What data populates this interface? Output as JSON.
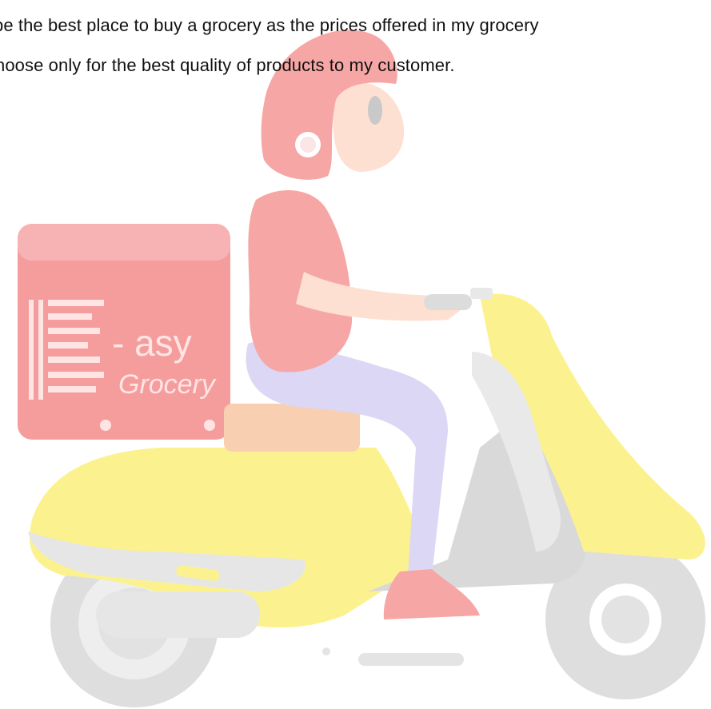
{
  "document": {
    "lines": [
      "be the best place to buy a grocery as the prices offered in my grocery",
      "hoose only for the best quality of products to my customer."
    ]
  },
  "illustration": {
    "subject": "delivery-scooter-rider-icon",
    "box_logo": {
      "brand_a": "- asy",
      "brand_b": "Grocery"
    },
    "colors": {
      "helmet": "#f7a6a6",
      "shirt": "#f7a6a6",
      "box": "#f59d9d",
      "scooter": "#fbf28f",
      "pants": "#dcd7f4",
      "tire": "#dedede",
      "seat": "#f8cfb0",
      "frame": "#e8e8e8"
    }
  }
}
